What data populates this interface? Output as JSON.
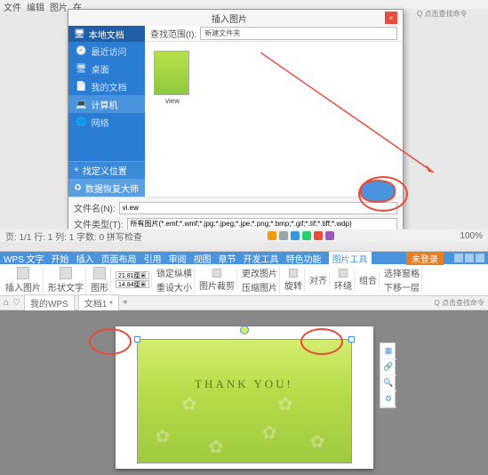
{
  "top": {
    "menu": [
      "文件",
      "编辑",
      "图片",
      "在..."
    ],
    "right_hint": "Q 点击查找命令"
  },
  "dialog": {
    "title": "插入图片",
    "close": "×",
    "path_label": "查找范围(I):",
    "path_value": "新建文件夹",
    "sidebar_header": "本地文档",
    "sidebar": [
      {
        "icon": "history-icon",
        "label": "最近访问"
      },
      {
        "icon": "desktop-icon",
        "label": "桌面"
      },
      {
        "icon": "docs-icon",
        "label": "我的文档"
      },
      {
        "icon": "computer-icon",
        "label": "计算机"
      },
      {
        "icon": "network-icon",
        "label": "网络"
      }
    ],
    "sidebar_btn1": "找定义位置",
    "sidebar_btn2": "数据恢复大师",
    "thumb_name": "view",
    "filename_label": "文件名(N):",
    "filename_value": "vi.ew",
    "filetype_label": "文件类型(T):",
    "filetype_value": "所有图片(*.emf;*.wmf;*.jpg;*.jpeg;*.jpe;*.png;*.bmp;*.gif;*.tif;*.tiff;*.wdp)"
  },
  "status": {
    "left": "页: 1/1  行: 1  列: 1  字数: 0  拼写检查",
    "right": "100%"
  },
  "wps": {
    "title": "WPS 文字",
    "tabs": [
      "开始",
      "插入",
      "页面布局",
      "引用",
      "审阅",
      "视图",
      "章节",
      "开发工具",
      "特色功能",
      "图片工具"
    ],
    "login": "未登录",
    "toolbar": {
      "insert_pic": "插入图片",
      "insert_txt": "形状文字",
      "shape": "图形",
      "sel_height": "21.81厘米",
      "sel_width": "14.84厘米",
      "lock": "锁定纵横",
      "reset": "重设大小",
      "crop": "图片裁剪",
      "change": "更改图片",
      "compress": "压缩图片",
      "rotate": "旋转",
      "align": "对齐",
      "wrap": "环绕",
      "combine": "组合",
      "select": "选择窗格",
      "below": "下移一层"
    },
    "doc_tabs": {
      "home": "我的WPS",
      "doc": "文档1 *"
    },
    "tabs_right": "Q 点击查找命令",
    "pic_text": "THANK YOU!"
  }
}
